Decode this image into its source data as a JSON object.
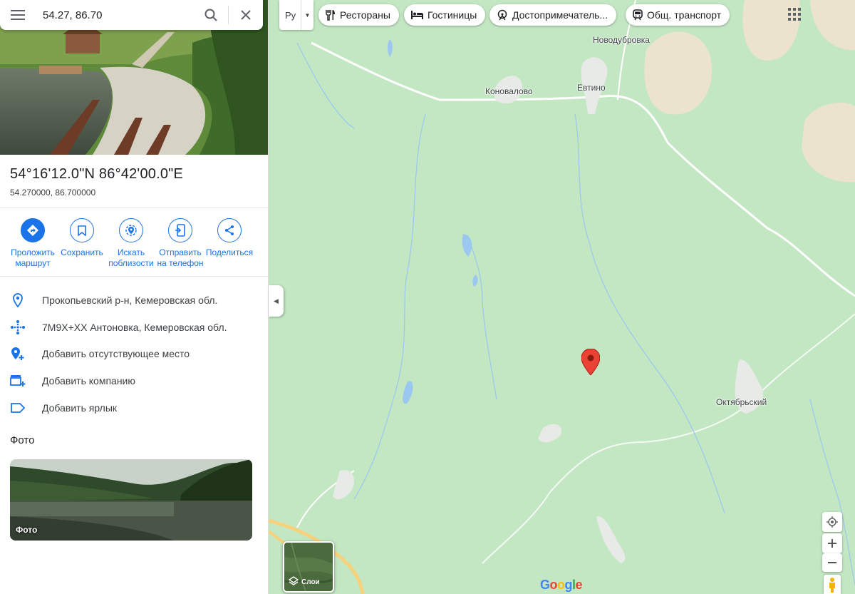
{
  "search": {
    "query": "54.27, 86.70"
  },
  "place": {
    "coords_dms": "54°16'12.0\"N 86°42'00.0\"E",
    "coords_decimal": "54.270000, 86.700000"
  },
  "actions": [
    {
      "label": "Проложить маршрут",
      "icon": "directions-icon"
    },
    {
      "label": "Сохранить",
      "icon": "bookmark-icon"
    },
    {
      "label": "Искать поблизости",
      "icon": "nearby-icon"
    },
    {
      "label": "Отправить на телефон",
      "icon": "send-to-phone-icon"
    },
    {
      "label": "Поделиться",
      "icon": "share-icon"
    }
  ],
  "info": [
    {
      "text": "Прокопьевский р-н, Кемеровская обл.",
      "icon": "location-pin-icon"
    },
    {
      "text": "7M9X+XX Антоновка, Кемеровская обл.",
      "icon": "plus-code-icon"
    },
    {
      "text": "Добавить отсутствующее место",
      "icon": "add-place-icon"
    },
    {
      "text": "Добавить компанию",
      "icon": "add-business-icon"
    },
    {
      "text": "Добавить ярлык",
      "icon": "label-icon"
    }
  ],
  "photos": {
    "heading": "Фото",
    "tile_label": "Фото"
  },
  "toolbar": {
    "language": "Ру",
    "chips": [
      {
        "label": "Рестораны",
        "icon": "restaurant-icon"
      },
      {
        "label": "Гостиницы",
        "icon": "hotel-icon"
      },
      {
        "label": "Достопримечатель...",
        "icon": "attractions-icon"
      },
      {
        "label": "Общ. транспорт",
        "icon": "transit-icon"
      }
    ]
  },
  "map": {
    "places": [
      "Новодубровка",
      "Коновалово",
      "Евтино",
      "Октябрьский"
    ],
    "layers_label": "Слои",
    "logo": "Google",
    "marker_color": "#ea4335",
    "accent_color": "#1a73e8"
  }
}
